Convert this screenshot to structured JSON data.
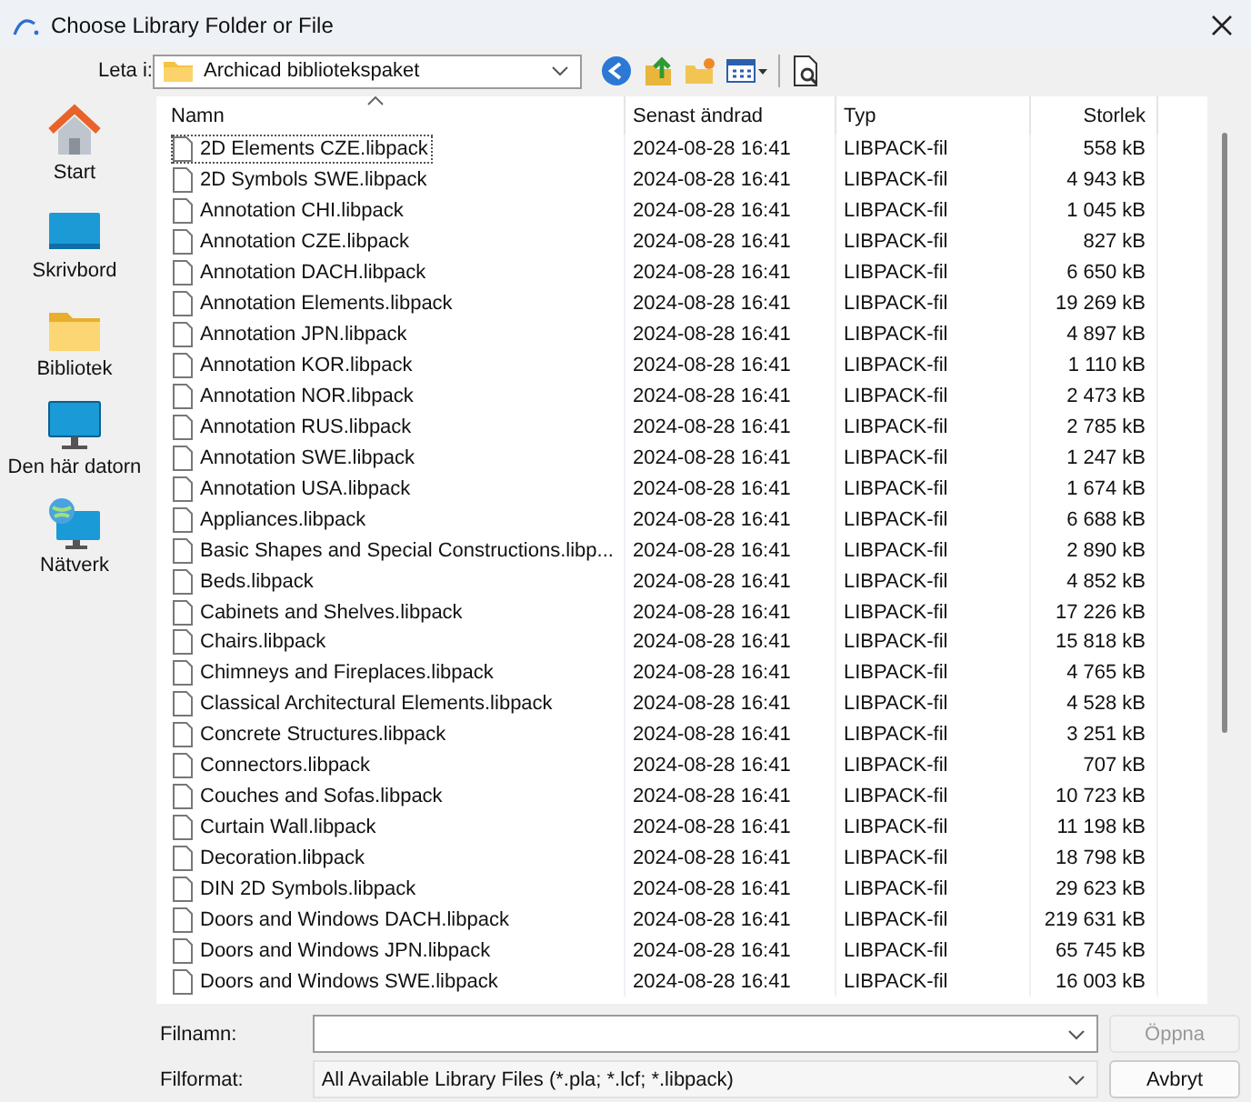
{
  "window": {
    "title": "Choose Library Folder or File"
  },
  "location": {
    "label": "Leta i:",
    "value": "Archicad bibliotekspaket"
  },
  "sidebar": {
    "items": [
      {
        "label": "Start",
        "kind": "home"
      },
      {
        "label": "Skrivbord",
        "kind": "desktop"
      },
      {
        "label": "Bibliotek",
        "kind": "folder"
      },
      {
        "label": "Den här datorn",
        "kind": "computer"
      },
      {
        "label": "Nätverk",
        "kind": "network"
      }
    ]
  },
  "table": {
    "columns": [
      {
        "label": "Namn",
        "sorted": true
      },
      {
        "label": "Senast ändrad",
        "sorted": false
      },
      {
        "label": "Typ",
        "sorted": false
      },
      {
        "label": "Storlek",
        "sorted": false
      }
    ],
    "rows": [
      {
        "name": "2D Elements CZE.libpack",
        "modified": "2024-08-28 16:41",
        "type": "LIBPACK-fil",
        "size": "558 kB",
        "focused": true
      },
      {
        "name": "2D Symbols SWE.libpack",
        "modified": "2024-08-28 16:41",
        "type": "LIBPACK-fil",
        "size": "4 943 kB",
        "focused": false
      },
      {
        "name": "Annotation CHI.libpack",
        "modified": "2024-08-28 16:41",
        "type": "LIBPACK-fil",
        "size": "1 045 kB",
        "focused": false
      },
      {
        "name": "Annotation CZE.libpack",
        "modified": "2024-08-28 16:41",
        "type": "LIBPACK-fil",
        "size": "827 kB",
        "focused": false
      },
      {
        "name": "Annotation DACH.libpack",
        "modified": "2024-08-28 16:41",
        "type": "LIBPACK-fil",
        "size": "6 650 kB",
        "focused": false
      },
      {
        "name": "Annotation Elements.libpack",
        "modified": "2024-08-28 16:41",
        "type": "LIBPACK-fil",
        "size": "19 269 kB",
        "focused": false
      },
      {
        "name": "Annotation JPN.libpack",
        "modified": "2024-08-28 16:41",
        "type": "LIBPACK-fil",
        "size": "4 897 kB",
        "focused": false
      },
      {
        "name": "Annotation KOR.libpack",
        "modified": "2024-08-28 16:41",
        "type": "LIBPACK-fil",
        "size": "1 110 kB",
        "focused": false
      },
      {
        "name": "Annotation NOR.libpack",
        "modified": "2024-08-28 16:41",
        "type": "LIBPACK-fil",
        "size": "2 473 kB",
        "focused": false
      },
      {
        "name": "Annotation RUS.libpack",
        "modified": "2024-08-28 16:41",
        "type": "LIBPACK-fil",
        "size": "2 785 kB",
        "focused": false
      },
      {
        "name": "Annotation SWE.libpack",
        "modified": "2024-08-28 16:41",
        "type": "LIBPACK-fil",
        "size": "1 247 kB",
        "focused": false
      },
      {
        "name": "Annotation USA.libpack",
        "modified": "2024-08-28 16:41",
        "type": "LIBPACK-fil",
        "size": "1 674 kB",
        "focused": false
      },
      {
        "name": "Appliances.libpack",
        "modified": "2024-08-28 16:41",
        "type": "LIBPACK-fil",
        "size": "6 688 kB",
        "focused": false
      },
      {
        "name": "Basic Shapes and Special Constructions.libp...",
        "modified": "2024-08-28 16:41",
        "type": "LIBPACK-fil",
        "size": "2 890 kB",
        "focused": false
      },
      {
        "name": "Beds.libpack",
        "modified": "2024-08-28 16:41",
        "type": "LIBPACK-fil",
        "size": "4 852 kB",
        "focused": false
      },
      {
        "name": "Cabinets and Shelves.libpack",
        "modified": "2024-08-28 16:41",
        "type": "LIBPACK-fil",
        "size": "17 226 kB",
        "focused": false
      },
      {
        "name": "Chairs.libpack",
        "modified": "2024-08-28 16:41",
        "type": "LIBPACK-fil",
        "size": "15 818 kB",
        "focused": false
      },
      {
        "name": "Chimneys and Fireplaces.libpack",
        "modified": "2024-08-28 16:41",
        "type": "LIBPACK-fil",
        "size": "4 765 kB",
        "focused": false
      },
      {
        "name": "Classical Architectural Elements.libpack",
        "modified": "2024-08-28 16:41",
        "type": "LIBPACK-fil",
        "size": "4 528 kB",
        "focused": false
      },
      {
        "name": "Concrete Structures.libpack",
        "modified": "2024-08-28 16:41",
        "type": "LIBPACK-fil",
        "size": "3 251 kB",
        "focused": false
      },
      {
        "name": "Connectors.libpack",
        "modified": "2024-08-28 16:41",
        "type": "LIBPACK-fil",
        "size": "707 kB",
        "focused": false
      },
      {
        "name": "Couches and Sofas.libpack",
        "modified": "2024-08-28 16:41",
        "type": "LIBPACK-fil",
        "size": "10 723 kB",
        "focused": false
      },
      {
        "name": "Curtain Wall.libpack",
        "modified": "2024-08-28 16:41",
        "type": "LIBPACK-fil",
        "size": "11 198 kB",
        "focused": false
      },
      {
        "name": "Decoration.libpack",
        "modified": "2024-08-28 16:41",
        "type": "LIBPACK-fil",
        "size": "18 798 kB",
        "focused": false
      },
      {
        "name": "DIN 2D Symbols.libpack",
        "modified": "2024-08-28 16:41",
        "type": "LIBPACK-fil",
        "size": "29 623 kB",
        "focused": false
      },
      {
        "name": "Doors and Windows DACH.libpack",
        "modified": "2024-08-28 16:41",
        "type": "LIBPACK-fil",
        "size": "219 631 kB",
        "focused": false
      },
      {
        "name": "Doors and Windows JPN.libpack",
        "modified": "2024-08-28 16:41",
        "type": "LIBPACK-fil",
        "size": "65 745 kB",
        "focused": false
      },
      {
        "name": "Doors and Windows SWE.libpack",
        "modified": "2024-08-28 16:41",
        "type": "LIBPACK-fil",
        "size": "16 003 kB",
        "focused": false
      }
    ]
  },
  "filename": {
    "label": "Filnamn:"
  },
  "format": {
    "label": "Filformat:",
    "value": "All Available Library Files (*.pla; *.lcf; *.libpack)"
  },
  "buttons": [
    {
      "label": "Öppna",
      "disabled": true
    },
    {
      "label": "Avbryt",
      "disabled": false
    }
  ]
}
